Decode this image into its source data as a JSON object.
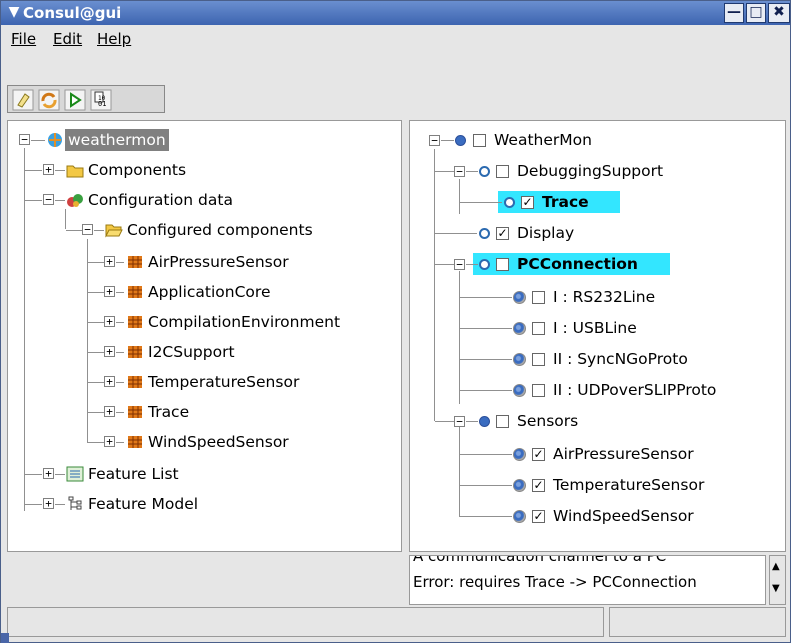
{
  "window": {
    "title": "Consul@gui"
  },
  "menu": {
    "file": {
      "label": "File"
    },
    "edit": {
      "label": "Edit"
    },
    "help": {
      "label": "Help"
    }
  },
  "toolbar": {
    "icons": [
      "eraser-icon",
      "refresh-icon",
      "play-icon",
      "binary-icon"
    ]
  },
  "left_tree": {
    "root": "weathermon",
    "components": "Components",
    "configuration_data": "Configuration data",
    "configured_components": "Configured components",
    "items": [
      "AirPressureSensor",
      "ApplicationCore",
      "CompilationEnvironment",
      "I2CSupport",
      "TemperatureSensor",
      "Trace",
      "WindSpeedSensor"
    ],
    "feature_list": "Feature List",
    "feature_model": "Feature Model"
  },
  "right_tree": {
    "weathermon": "WeatherMon",
    "debugging_support": "DebuggingSupport",
    "trace": "Trace",
    "display": "Display",
    "pcconnection": "PCConnection",
    "rs232": "I : RS232Line",
    "usb": "I : USBLine",
    "syncngo": "II : SyncNGoProto",
    "udpover": "II : UDPoverSLIPProto",
    "sensors": "Sensors",
    "air": "AirPressureSensor",
    "temp": "TemperatureSensor",
    "wind": "WindSpeedSensor"
  },
  "info": {
    "line1": "A communication channel to a PC",
    "line2": "Error: requires Trace ->  PCConnection"
  },
  "colors": {
    "title_bar": "#3d64b0",
    "highlight": "#33e6ff",
    "selection": "#808080"
  }
}
